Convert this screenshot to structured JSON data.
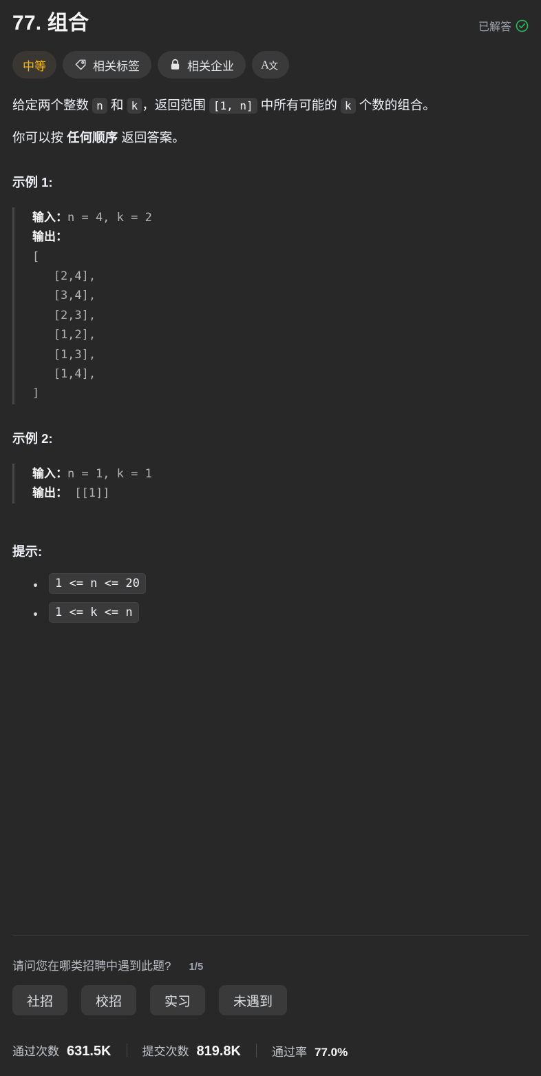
{
  "header": {
    "title": "77. 组合",
    "solved_label": "已解答",
    "solved_icon": "check-circle-icon",
    "solved_color": "#2cbb5d"
  },
  "tags": [
    {
      "label": "中等",
      "icon": null,
      "name": "difficulty-tag",
      "color": "#ffb800"
    },
    {
      "label": "相关标签",
      "icon": "tag-icon",
      "name": "topics-tag"
    },
    {
      "label": "相关企业",
      "icon": "lock-icon",
      "name": "companies-tag"
    },
    {
      "label": "A文",
      "icon": "translate-icon",
      "name": "translate-button"
    }
  ],
  "description": {
    "p1": {
      "seg1": "给定两个整数 ",
      "code1": "n",
      "seg2": " 和 ",
      "code2": "k",
      "seg3": "，返回范围 ",
      "code3": "[1, n]",
      "seg4": " 中所有可能的 ",
      "code4": "k",
      "seg5": " 个数的组合。"
    },
    "p2": {
      "seg1": "你可以按 ",
      "bold": "任何顺序",
      "seg2": " 返回答案。"
    }
  },
  "examples": [
    {
      "title": "示例 1:",
      "input_label": "输入：",
      "input_value": "n = 4, k = 2",
      "output_label": "输出：",
      "output_value": "\n[\n   [2,4],\n   [3,4],\n   [2,3],\n   [1,2],\n   [1,3],\n   [1,4],\n]"
    },
    {
      "title": "示例 2:",
      "input_label": "输入：",
      "input_value": "n = 1, k = 1",
      "output_label": "输出：",
      "output_value": " [[1]]"
    }
  ],
  "constraints": {
    "title": "提示:",
    "items": [
      "1 <= n <= 20",
      "1 <= k <= n"
    ]
  },
  "survey": {
    "question": "请问您在哪类招聘中遇到此题?",
    "progress": "1/5",
    "options": [
      "社招",
      "校招",
      "实习",
      "未遇到"
    ]
  },
  "stats": [
    {
      "label": "通过次数",
      "value": "631.5K"
    },
    {
      "label": "提交次数",
      "value": "819.8K"
    },
    {
      "label": "通过率",
      "value": "77.0%"
    }
  ]
}
